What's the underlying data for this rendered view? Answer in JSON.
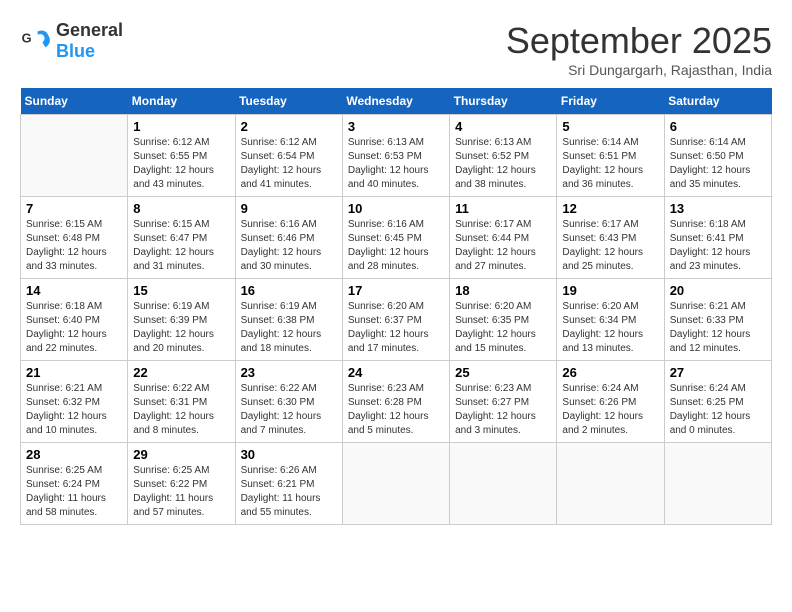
{
  "header": {
    "logo_general": "General",
    "logo_blue": "Blue",
    "month_title": "September 2025",
    "subtitle": "Sri Dungargarh, Rajasthan, India"
  },
  "weekdays": [
    "Sunday",
    "Monday",
    "Tuesday",
    "Wednesday",
    "Thursday",
    "Friday",
    "Saturday"
  ],
  "weeks": [
    [
      {
        "day": "",
        "info": ""
      },
      {
        "day": "1",
        "info": "Sunrise: 6:12 AM\nSunset: 6:55 PM\nDaylight: 12 hours\nand 43 minutes."
      },
      {
        "day": "2",
        "info": "Sunrise: 6:12 AM\nSunset: 6:54 PM\nDaylight: 12 hours\nand 41 minutes."
      },
      {
        "day": "3",
        "info": "Sunrise: 6:13 AM\nSunset: 6:53 PM\nDaylight: 12 hours\nand 40 minutes."
      },
      {
        "day": "4",
        "info": "Sunrise: 6:13 AM\nSunset: 6:52 PM\nDaylight: 12 hours\nand 38 minutes."
      },
      {
        "day": "5",
        "info": "Sunrise: 6:14 AM\nSunset: 6:51 PM\nDaylight: 12 hours\nand 36 minutes."
      },
      {
        "day": "6",
        "info": "Sunrise: 6:14 AM\nSunset: 6:50 PM\nDaylight: 12 hours\nand 35 minutes."
      }
    ],
    [
      {
        "day": "7",
        "info": "Sunrise: 6:15 AM\nSunset: 6:48 PM\nDaylight: 12 hours\nand 33 minutes."
      },
      {
        "day": "8",
        "info": "Sunrise: 6:15 AM\nSunset: 6:47 PM\nDaylight: 12 hours\nand 31 minutes."
      },
      {
        "day": "9",
        "info": "Sunrise: 6:16 AM\nSunset: 6:46 PM\nDaylight: 12 hours\nand 30 minutes."
      },
      {
        "day": "10",
        "info": "Sunrise: 6:16 AM\nSunset: 6:45 PM\nDaylight: 12 hours\nand 28 minutes."
      },
      {
        "day": "11",
        "info": "Sunrise: 6:17 AM\nSunset: 6:44 PM\nDaylight: 12 hours\nand 27 minutes."
      },
      {
        "day": "12",
        "info": "Sunrise: 6:17 AM\nSunset: 6:43 PM\nDaylight: 12 hours\nand 25 minutes."
      },
      {
        "day": "13",
        "info": "Sunrise: 6:18 AM\nSunset: 6:41 PM\nDaylight: 12 hours\nand 23 minutes."
      }
    ],
    [
      {
        "day": "14",
        "info": "Sunrise: 6:18 AM\nSunset: 6:40 PM\nDaylight: 12 hours\nand 22 minutes."
      },
      {
        "day": "15",
        "info": "Sunrise: 6:19 AM\nSunset: 6:39 PM\nDaylight: 12 hours\nand 20 minutes."
      },
      {
        "day": "16",
        "info": "Sunrise: 6:19 AM\nSunset: 6:38 PM\nDaylight: 12 hours\nand 18 minutes."
      },
      {
        "day": "17",
        "info": "Sunrise: 6:20 AM\nSunset: 6:37 PM\nDaylight: 12 hours\nand 17 minutes."
      },
      {
        "day": "18",
        "info": "Sunrise: 6:20 AM\nSunset: 6:35 PM\nDaylight: 12 hours\nand 15 minutes."
      },
      {
        "day": "19",
        "info": "Sunrise: 6:20 AM\nSunset: 6:34 PM\nDaylight: 12 hours\nand 13 minutes."
      },
      {
        "day": "20",
        "info": "Sunrise: 6:21 AM\nSunset: 6:33 PM\nDaylight: 12 hours\nand 12 minutes."
      }
    ],
    [
      {
        "day": "21",
        "info": "Sunrise: 6:21 AM\nSunset: 6:32 PM\nDaylight: 12 hours\nand 10 minutes."
      },
      {
        "day": "22",
        "info": "Sunrise: 6:22 AM\nSunset: 6:31 PM\nDaylight: 12 hours\nand 8 minutes."
      },
      {
        "day": "23",
        "info": "Sunrise: 6:22 AM\nSunset: 6:30 PM\nDaylight: 12 hours\nand 7 minutes."
      },
      {
        "day": "24",
        "info": "Sunrise: 6:23 AM\nSunset: 6:28 PM\nDaylight: 12 hours\nand 5 minutes."
      },
      {
        "day": "25",
        "info": "Sunrise: 6:23 AM\nSunset: 6:27 PM\nDaylight: 12 hours\nand 3 minutes."
      },
      {
        "day": "26",
        "info": "Sunrise: 6:24 AM\nSunset: 6:26 PM\nDaylight: 12 hours\nand 2 minutes."
      },
      {
        "day": "27",
        "info": "Sunrise: 6:24 AM\nSunset: 6:25 PM\nDaylight: 12 hours\nand 0 minutes."
      }
    ],
    [
      {
        "day": "28",
        "info": "Sunrise: 6:25 AM\nSunset: 6:24 PM\nDaylight: 11 hours\nand 58 minutes."
      },
      {
        "day": "29",
        "info": "Sunrise: 6:25 AM\nSunset: 6:22 PM\nDaylight: 11 hours\nand 57 minutes."
      },
      {
        "day": "30",
        "info": "Sunrise: 6:26 AM\nSunset: 6:21 PM\nDaylight: 11 hours\nand 55 minutes."
      },
      {
        "day": "",
        "info": ""
      },
      {
        "day": "",
        "info": ""
      },
      {
        "day": "",
        "info": ""
      },
      {
        "day": "",
        "info": ""
      }
    ]
  ]
}
